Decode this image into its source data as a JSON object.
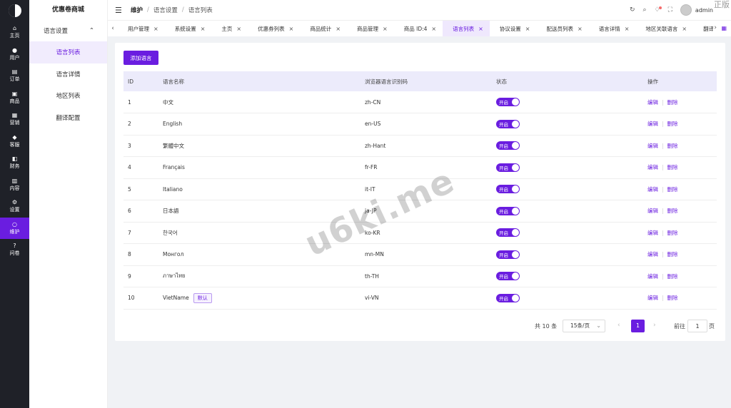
{
  "rail": {
    "items": [
      {
        "icon": "home-icon",
        "glyph": "⌂",
        "label": "主页"
      },
      {
        "icon": "user-icon",
        "glyph": "●",
        "label": "用户"
      },
      {
        "icon": "order-icon",
        "glyph": "▤",
        "label": "订单"
      },
      {
        "icon": "goods-icon",
        "glyph": "▣",
        "label": "商品"
      },
      {
        "icon": "marketing-icon",
        "glyph": "▦",
        "label": "营销"
      },
      {
        "icon": "service-icon",
        "glyph": "◆",
        "label": "客服"
      },
      {
        "icon": "finance-icon",
        "glyph": "◧",
        "label": "财务"
      },
      {
        "icon": "content-icon",
        "glyph": "▥",
        "label": "内容"
      },
      {
        "icon": "settings-icon",
        "glyph": "⚙",
        "label": "设置"
      },
      {
        "icon": "maintenance-icon",
        "glyph": "○",
        "label": "维护",
        "active": true
      },
      {
        "icon": "survey-icon",
        "glyph": "?",
        "label": "问卷"
      }
    ]
  },
  "side": {
    "title": "优惠卷商城",
    "group": "语言设置",
    "items": [
      "语言列表",
      "语言详情",
      "地区列表",
      "翻译配置"
    ],
    "active_index": 0
  },
  "header": {
    "breadcrumb": [
      "维护",
      "语言设置",
      "语言列表"
    ],
    "user": "admin",
    "corner_text": "正版"
  },
  "tabs": [
    {
      "label": "用户管理"
    },
    {
      "label": "系统设置"
    },
    {
      "label": "主页"
    },
    {
      "label": "优惠券列表"
    },
    {
      "label": "商品统计"
    },
    {
      "label": "商品管理"
    },
    {
      "label": "商品 ID:4"
    },
    {
      "label": "语言列表",
      "active": true
    },
    {
      "label": "协议设置"
    },
    {
      "label": "配送员列表"
    },
    {
      "label": "语言详情"
    },
    {
      "label": "地区关联语言"
    },
    {
      "label": "翻译配置"
    }
  ],
  "main": {
    "add_button": "添加语言",
    "columns": [
      "ID",
      "语言名称",
      "浏览器语言识别码",
      "状态",
      "操作"
    ],
    "status_on": "开启",
    "edit": "编辑",
    "delete": "删除",
    "default_tag": "默认",
    "rows": [
      {
        "id": "1",
        "name": "中文",
        "code": "zh-CN"
      },
      {
        "id": "2",
        "name": "English",
        "code": "en-US"
      },
      {
        "id": "3",
        "name": "繁體中文",
        "code": "zh-Hant"
      },
      {
        "id": "4",
        "name": "Français",
        "code": "fr-FR"
      },
      {
        "id": "5",
        "name": "Italiano",
        "code": "it-IT"
      },
      {
        "id": "6",
        "name": "日本語",
        "code": "ja-JP"
      },
      {
        "id": "7",
        "name": "한국어",
        "code": "ko-KR"
      },
      {
        "id": "8",
        "name": "Монгол",
        "code": "mn-MN"
      },
      {
        "id": "9",
        "name": "ภาษาไทย",
        "code": "th-TH"
      },
      {
        "id": "10",
        "name": "VietName",
        "code": "vi-VN",
        "default": true
      }
    ]
  },
  "pager": {
    "total": "共 10 条",
    "page_size": "15条/页",
    "current": "1",
    "goto_label": "前往",
    "goto_value": "1",
    "page_label": "页"
  },
  "watermark": "u6ki.me",
  "colors": {
    "accent": "#6a1de0",
    "rail": "#1f2128"
  }
}
